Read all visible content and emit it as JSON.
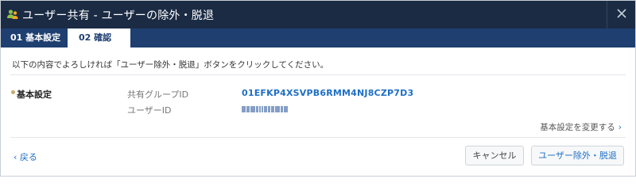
{
  "dialog": {
    "title": "ユーザー共有 - ユーザーの除外・脱退",
    "close_icon": "close-icon",
    "title_icon": "users-icon"
  },
  "tabs": [
    {
      "label": "01 基本設定",
      "active": false
    },
    {
      "label": "02 確認",
      "active": true
    }
  ],
  "instruction": "以下の内容でよろしければ「ユーザー除外・脱退」ボタンをクリックしてください。",
  "section": {
    "label": "基本設定",
    "fields": [
      {
        "label": "共有グループID",
        "value": "01EFKP4XSVPB6RMM4NJ8CZP7D3"
      },
      {
        "label": "ユーザーID",
        "value": ""
      }
    ],
    "change_link": "基本設定を変更する"
  },
  "footer": {
    "back_label": "戻る",
    "cancel_label": "キャンセル",
    "primary_label": "ユーザー除外・脱退"
  },
  "colors": {
    "titlebar": "#1b2b44",
    "tabbar": "#1e3f70",
    "link": "#1f6fc5",
    "accent_dot": "#c8aa70"
  }
}
